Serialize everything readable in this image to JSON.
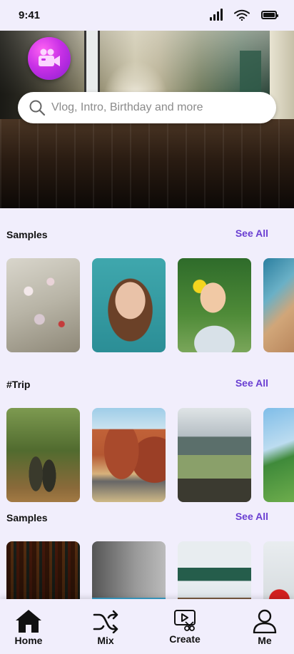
{
  "status_bar": {
    "time": "9:41",
    "signal_icon": "cellular-signal-icon",
    "wifi_icon": "wifi-icon",
    "battery_icon": "battery-icon"
  },
  "header": {
    "logo_icon": "video-camera-icon",
    "hero_image": "school-corridor-photo"
  },
  "search": {
    "placeholder": "Vlog, Intro, Birthday and more",
    "icon": "search-icon"
  },
  "sections": [
    {
      "title": "Samples",
      "see_all": "See All",
      "items": [
        "flowers-photo",
        "portrait-photo",
        "girl-painting-photo",
        "desk-photo"
      ]
    },
    {
      "title": "#Trip",
      "see_all": "See All",
      "items": [
        "forest-hikers-photo",
        "canyon-road-photo",
        "mountain-view-photo",
        "palm-tree-photo"
      ]
    },
    {
      "title": "Samples",
      "see_all": "See All",
      "items": [
        "library-photo",
        "books-photo",
        "classroom-photo",
        "apple-photo"
      ]
    }
  ],
  "nav": {
    "items": [
      {
        "label": "Home",
        "icon": "home-icon"
      },
      {
        "label": "Mix",
        "icon": "shuffle-icon"
      },
      {
        "label": "Create",
        "icon": "create-video-icon"
      },
      {
        "label": "Me",
        "icon": "user-icon"
      }
    ]
  },
  "colors": {
    "background": "#f1eefc",
    "accent": "#6a3fd2",
    "logo": "#c830e6"
  }
}
